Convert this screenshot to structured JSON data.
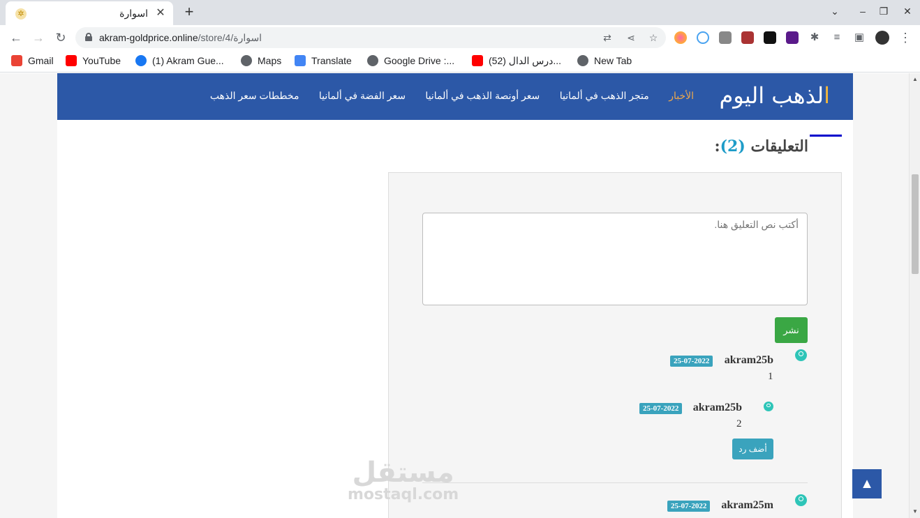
{
  "browser": {
    "tab_title": "اسوارة",
    "tab_close": "✕",
    "new_tab": "+",
    "url_domain": "akram-goldprice.online",
    "url_path": "/store/4/اسوارة",
    "bookmarks": [
      {
        "label": "Gmail",
        "icon": "gmail-icon",
        "color": "#ea4335"
      },
      {
        "label": "YouTube",
        "icon": "youtube-icon",
        "color": "#ff0000"
      },
      {
        "label": "(1) Akram Gue...",
        "icon": "facebook-icon",
        "color": "#1877f2"
      },
      {
        "label": "Maps",
        "icon": "globe-icon",
        "color": "#5f6368"
      },
      {
        "label": "Translate",
        "icon": "translate-icon",
        "color": "#4285f4"
      },
      {
        "label": "Google Drive :...",
        "icon": "globe-icon",
        "color": "#5f6368"
      },
      {
        "label": "(52) درس الدال...",
        "icon": "youtube-icon",
        "color": "#ff0000"
      },
      {
        "label": "New Tab",
        "icon": "globe-icon",
        "color": "#5f6368"
      }
    ]
  },
  "site": {
    "brand_first": "ا",
    "brand_rest": "لذهب اليوم",
    "nav": [
      {
        "label": "الأخبار",
        "active": true
      },
      {
        "label": "متجر الذهب في ألمانيا",
        "active": false
      },
      {
        "label": "سعر أونصة الذهب في ألمانيا",
        "active": false
      },
      {
        "label": "سعر الفضة في ألمانيا",
        "active": false
      },
      {
        "label": "مخططات سعر الذهب",
        "active": false
      }
    ],
    "colors": {
      "navbar": "#2c58a7",
      "accent": "#f3b73a",
      "post_button": "#3aa744",
      "badge": "#3aa3bd"
    }
  },
  "comments": {
    "title": "التعليقات",
    "count": "(2)",
    "suffix": ":",
    "placeholder": "أكتب نص التعليق هنا.",
    "post_label": "نشر",
    "reply_label": "أضف رد",
    "items": [
      {
        "user": "akram25b",
        "date": "25-07-2022",
        "text": "1"
      },
      {
        "user": "akram25b",
        "date": "25-07-2022",
        "text": "2"
      },
      {
        "user": "akram25m",
        "date": "25-07-2022",
        "text": ""
      }
    ]
  },
  "watermark": {
    "ar": "مستقل",
    "en": "mostaql.com"
  },
  "to_top_label": "▲"
}
